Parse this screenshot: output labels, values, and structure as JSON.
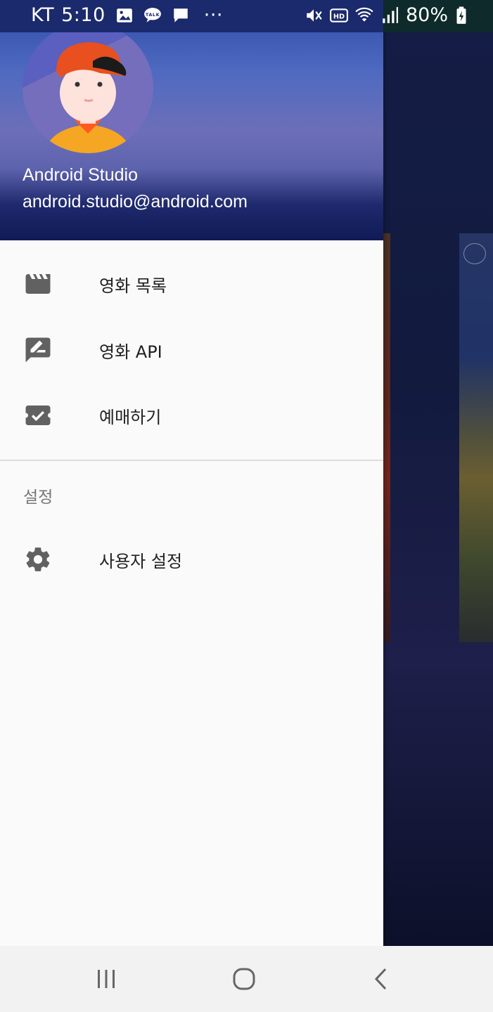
{
  "status_bar": {
    "carrier": "KT",
    "time": "5:10",
    "more": "···",
    "battery": "80%",
    "notifications": [
      "image-icon",
      "talk-icon",
      "message-icon"
    ],
    "system_icons": [
      "mute-icon",
      "hd-icon",
      "wifi-icon",
      "signal-icon",
      "battery-charging-icon"
    ]
  },
  "drawer": {
    "header": {
      "name": "Android Studio",
      "email": "android.studio@android.com"
    },
    "items": [
      {
        "icon": "movie-icon",
        "label": "영화 목록"
      },
      {
        "icon": "rate-review-icon",
        "label": "영화 API"
      },
      {
        "icon": "ticket-check-icon",
        "label": "예매하기"
      }
    ],
    "section": {
      "title": "설정",
      "items": [
        {
          "icon": "settings-gear-icon",
          "label": "사용자 설정"
        }
      ]
    }
  },
  "nav_bar": {
    "buttons": [
      "recent-apps-icon",
      "home-icon",
      "back-icon"
    ]
  },
  "colors": {
    "drawer_bg": "#fafafa",
    "icon_gray": "#616161",
    "nav_bg": "#f2f2f2"
  }
}
